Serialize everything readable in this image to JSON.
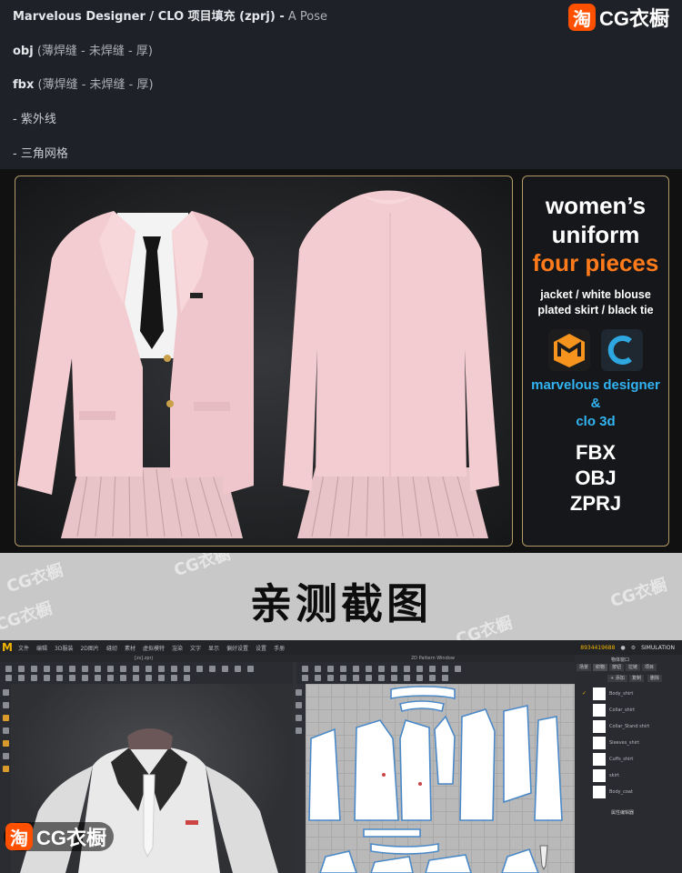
{
  "header": {
    "line1": {
      "main": "Marvelous Designer / CLO 项目填充 (zprj) -",
      "sub": "A Pose"
    },
    "line2": {
      "main": "obj",
      "sub": "(薄焊缝 - 未焊缝 - 厚)"
    },
    "line3": {
      "main": "fbx",
      "sub": "(薄焊缝 - 未焊缝 - 厚)"
    },
    "line4": "- 紫外线",
    "line5": "- 三角网格"
  },
  "brand": {
    "icon": "淘",
    "name": "CG衣橱"
  },
  "banner": {
    "title1": "women’s",
    "title2": "uniform",
    "highlight": "four pieces",
    "items1": "jacket / white blouse",
    "items2": "plated skirt / black tie",
    "software1": "marvelous designer",
    "amp": "&",
    "software2": "clo 3d",
    "formats": [
      "FBX",
      "OBJ",
      "ZPRJ"
    ],
    "colors": {
      "accent": "#ff7a1a",
      "software": "#32b3f2",
      "frame": "#b39a67"
    }
  },
  "band": {
    "title": "亲测截图",
    "watermark": "CG衣橱"
  },
  "app": {
    "logo": "M",
    "menu": [
      "文件",
      "编辑",
      "3D服装",
      "2D图片",
      "缝纫",
      "素材",
      "虚拟模特",
      "渲染",
      "文字",
      "显示",
      "偏好设置",
      "设置",
      "手册"
    ],
    "counter": "8934419688",
    "simulation": "SIMULATION",
    "tab3d": "[zs].zprj",
    "tab2d": "2D Pattern Window",
    "panel_title": "物体窗口",
    "panel_tabs": [
      "场景",
      "织物",
      "按钮",
      "拉链",
      "项目"
    ],
    "panel_buttons": [
      "+ 添加",
      "复制",
      "删除"
    ],
    "fabrics": [
      "Body_shirt",
      "Collar_shirt",
      "Collar_Stand shirt",
      "Sleeves_shirt",
      "Cuffs_shirt",
      "skirt",
      "Body_coat"
    ],
    "panel_footer": "属性编辑器"
  },
  "watermark_badge": {
    "icon": "淘",
    "name": "CG衣橱"
  }
}
